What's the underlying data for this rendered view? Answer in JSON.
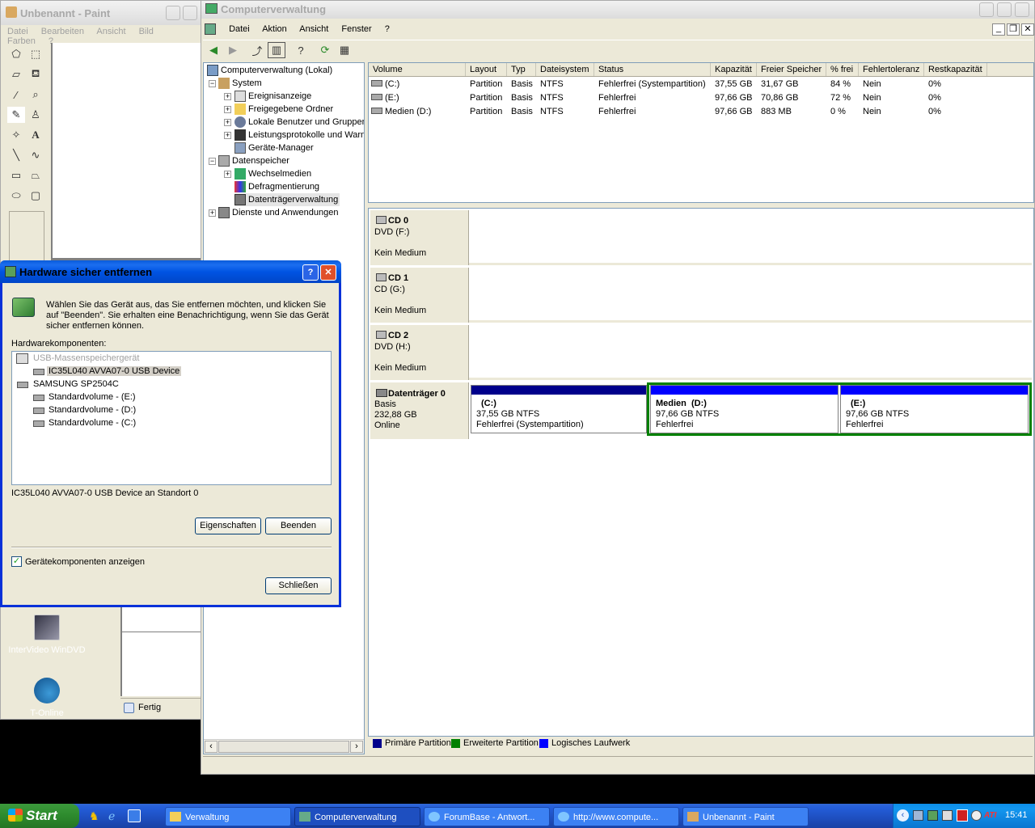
{
  "paint": {
    "title": "Unbenannt - Paint",
    "menu": [
      "Datei",
      "Bearbeiten",
      "Ansicht",
      "Bild",
      "Farben",
      "?"
    ],
    "status_text": "Fertig"
  },
  "mmc": {
    "title": "Computerverwaltung",
    "menu": [
      "Datei",
      "Aktion",
      "Ansicht",
      "Fenster",
      "?"
    ],
    "tree": [
      "Computerverwaltung (Lokal)",
      "System",
      "Ereignisanzeige",
      "Freigegebene Ordner",
      "Lokale Benutzer und Gruppen",
      "Leistungsprotokolle und Warnungen",
      "Geräte-Manager",
      "Datenspeicher",
      "Wechselmedien",
      "Defragmentierung",
      "Datenträgerverwaltung",
      "Dienste und Anwendungen"
    ],
    "columns": [
      "Volume",
      "Layout",
      "Typ",
      "Dateisystem",
      "Status",
      "Kapazität",
      "Freier Speicher",
      "% frei",
      "Fehlertoleranz",
      "Restkapazität"
    ],
    "volumes": [
      {
        "name": "(C:)",
        "layout": "Partition",
        "typ": "Basis",
        "fs": "NTFS",
        "status": "Fehlerfrei (Systempartition)",
        "cap": "37,55 GB",
        "free": "31,67 GB",
        "pct": "84 %",
        "ft": "Nein",
        "rest": "0%"
      },
      {
        "name": "(E:)",
        "layout": "Partition",
        "typ": "Basis",
        "fs": "NTFS",
        "status": "Fehlerfrei",
        "cap": "97,66 GB",
        "free": "70,86 GB",
        "pct": "72 %",
        "ft": "Nein",
        "rest": "0%"
      },
      {
        "name": "Medien (D:)",
        "layout": "Partition",
        "typ": "Basis",
        "fs": "NTFS",
        "status": "Fehlerfrei",
        "cap": "97,66 GB",
        "free": "883 MB",
        "pct": "0 %",
        "ft": "Nein",
        "rest": "0%"
      }
    ],
    "disks": [
      {
        "name": "CD 0",
        "line1": "DVD (F:)",
        "line2": "Kein Medium"
      },
      {
        "name": "CD 1",
        "line1": "CD (G:)",
        "line2": "Kein Medium"
      },
      {
        "name": "CD 2",
        "line1": "DVD (H:)",
        "line2": "Kein Medium"
      }
    ],
    "disk0": {
      "name": "Datenträger 0",
      "type": "Basis",
      "size": "232,88 GB",
      "state": "Online",
      "partitions": [
        {
          "title": "(C:)",
          "size": "37,55 GB NTFS",
          "status": "Fehlerfrei (Systempartition)"
        },
        {
          "title": "Medien  (D:)",
          "size": "97,66 GB NTFS",
          "status": "Fehlerfrei"
        },
        {
          "title": "(E:)",
          "size": "97,66 GB NTFS",
          "status": "Fehlerfrei"
        }
      ]
    },
    "legend": [
      "Primäre Partition",
      "Erweiterte Partition",
      "Logisches Laufwerk"
    ]
  },
  "dialog": {
    "title": "Hardware sicher entfernen",
    "intro": "Wählen Sie das Gerät aus, das Sie entfernen möchten, und klicken Sie auf \"Beenden\". Sie erhalten eine Benachrichtigung, wenn Sie das Gerät sicher entfernen können.",
    "list_label": "Hardwarekomponenten:",
    "items": [
      "USB-Massenspeichergerät",
      "IC35L040 AVVA07-0 USB Device",
      "SAMSUNG SP2504C",
      "Standardvolume - (E:)",
      "Standardvolume - (D:)",
      "Standardvolume - (C:)"
    ],
    "location": "IC35L040 AVVA07-0 USB Device an Standort 0",
    "btn_props": "Eigenschaften",
    "btn_stop": "Beenden",
    "checkbox_label": "Gerätekomponenten anzeigen",
    "btn_close": "Schließen"
  },
  "desktop": {
    "icons": [
      "InterVideo WinDVD",
      "T-Online"
    ]
  },
  "taskbar": {
    "start": "Start",
    "tasks": [
      "Verwaltung",
      "Computerverwaltung",
      "ForumBase - Antwort...",
      "http://www.compute...",
      "Unbenannt - Paint"
    ],
    "clock": "15:41"
  },
  "colors": {
    "primary_partition": "#00008b",
    "extended_partition": "#008000",
    "logical_drive": "#0000ff"
  }
}
